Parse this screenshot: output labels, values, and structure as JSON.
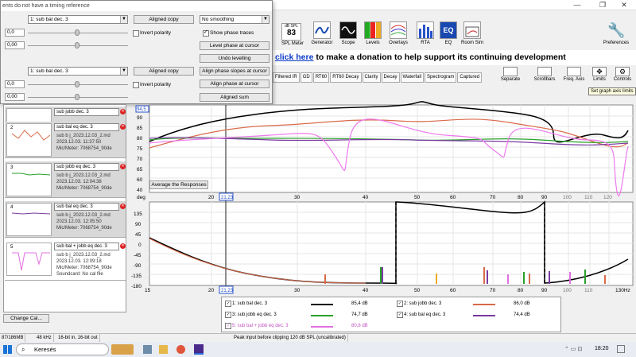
{
  "window": {
    "minimize": "—",
    "restore": "❐",
    "close": "✕"
  },
  "dialog": {
    "title": "ents do not have a timing reference",
    "row1": {
      "select": "1: sub bal dec. 3",
      "button": "Aligned copy",
      "value_a": "0,0",
      "value_b": "0,00",
      "invert": "Invert polarity"
    },
    "row2": {
      "select": "1: sub bal dec. 3",
      "button": "Aligned copy",
      "value_a": "0,0",
      "value_b": "0,00",
      "invert": "Invert polarity"
    },
    "smoothing": "No smoothing",
    "show_phase": "Show phase traces",
    "buttons": [
      "Level phase at cursor",
      "Undo levelling",
      "Align phase slopes at cursor",
      "Align phase at cursor",
      "Aligned sum"
    ]
  },
  "toolbar": {
    "spl_label": "dB SPL",
    "spl_value": "83",
    "items": [
      "SPL Meter",
      "Generator",
      "Scope",
      "Levels",
      "Overlays",
      "RTA",
      "EQ",
      "Room Sim"
    ],
    "preferences": "Preferences"
  },
  "banner": {
    "link": "click here",
    "text": " to make a donation to help support its continuing development"
  },
  "tabs": [
    "Filtered IR",
    "GD",
    "RT60",
    "RT60 Decay",
    "Clarity",
    "Decay",
    "Waterfall",
    "Spectrogram",
    "Captured"
  ],
  "right_tools": [
    "Separate",
    "Scrollbars",
    "Freq. Axis",
    "Limits",
    "Controls"
  ],
  "tooltip": "Set graph axis limits",
  "measurements": [
    {
      "idx": "",
      "name": "sub jobb dec. 3",
      "line1": "",
      "line2": "",
      "line3": "",
      "line4": "",
      "color": "#000000"
    },
    {
      "idx": "2",
      "name": "sub bal eq dec. 3",
      "line1": "sub b j_2023.12.03_2.md",
      "line2": "2023.12.03. 11:37:50",
      "line3": "Mic/Meter: 7068754_90de",
      "line4": "",
      "color": "#d96a4a"
    },
    {
      "idx": "3",
      "name": "sub jobb eq dec. 3",
      "line1": "sub b j_2023.12.03_2.md",
      "line2": "2023.12.03. 12:04:38",
      "line3": "Mic/Meter: 7068754_90de",
      "line4": "",
      "color": "#2aa02a"
    },
    {
      "idx": "4",
      "name": "sub bal eq dec. 3",
      "line1": "sub b j_2023.12.03_2.md",
      "line2": "2023.12.03. 12:05:50",
      "line3": "Mic/Meter: 7068754_90de",
      "line4": "",
      "color": "#7a3aa0"
    },
    {
      "idx": "5",
      "name": "sub bal + jobb eq dec. 3",
      "line1": "sub b j_2023.12.03_2.md",
      "line2": "2023.12.03. 12:09:18",
      "line3": "Mic/Meter: 7068754_90de",
      "line4": "Soundcard: No cal file",
      "color": "#e070e0"
    }
  ],
  "change_cal": "Change Cal...",
  "average_button": "Average the Responses",
  "graph": {
    "spl_unit": "dB",
    "phase_unit": "deg",
    "spl_ticks": [
      "90",
      "85",
      "80",
      "75",
      "70",
      "65",
      "60",
      "55",
      "50",
      "45",
      "40"
    ],
    "spl_cursor_value": "94,5",
    "phase_ticks": [
      "135",
      "90",
      "45",
      "0",
      "-45",
      "-90",
      "-135",
      "-180"
    ],
    "freq_ticks": [
      "20",
      "30",
      "40",
      "50",
      "60",
      "70",
      "80",
      "90",
      "100",
      "110",
      "120"
    ],
    "freq_ticks_bottom": [
      "15",
      "20",
      "30",
      "40",
      "50",
      "60",
      "70",
      "80",
      "90",
      "100",
      "110",
      "130Hz"
    ],
    "cursor_label": "21,23",
    "top_freq_label": "20",
    "first_bottom_label": "20"
  },
  "legend": [
    {
      "label": "1: sub bal dec. 3",
      "value": "85,4 dB",
      "color": "#000000"
    },
    {
      "label": "2: sub jobb dec. 3",
      "value": "86,0 dB",
      "color": "#d96a4a"
    },
    {
      "label": "3: sub jobb eq dec. 3",
      "value": "74,7 dB",
      "color": "#2aa02a"
    },
    {
      "label": "4: sub bal eq dec. 3",
      "value": "74,4 dB",
      "color": "#7a3aa0"
    },
    {
      "label": "5: sub bal + jobb eq dec. 3",
      "value": "80,8 dB",
      "color": "#e070e0"
    }
  ],
  "status": [
    "87/186MB",
    "48 kHz",
    "16-bit in, 16-bit out",
    "Peak input before clipping 120 dB SPL (uncalibrated)"
  ],
  "taskbar": {
    "search": "Keresés",
    "time": "18:20"
  }
}
